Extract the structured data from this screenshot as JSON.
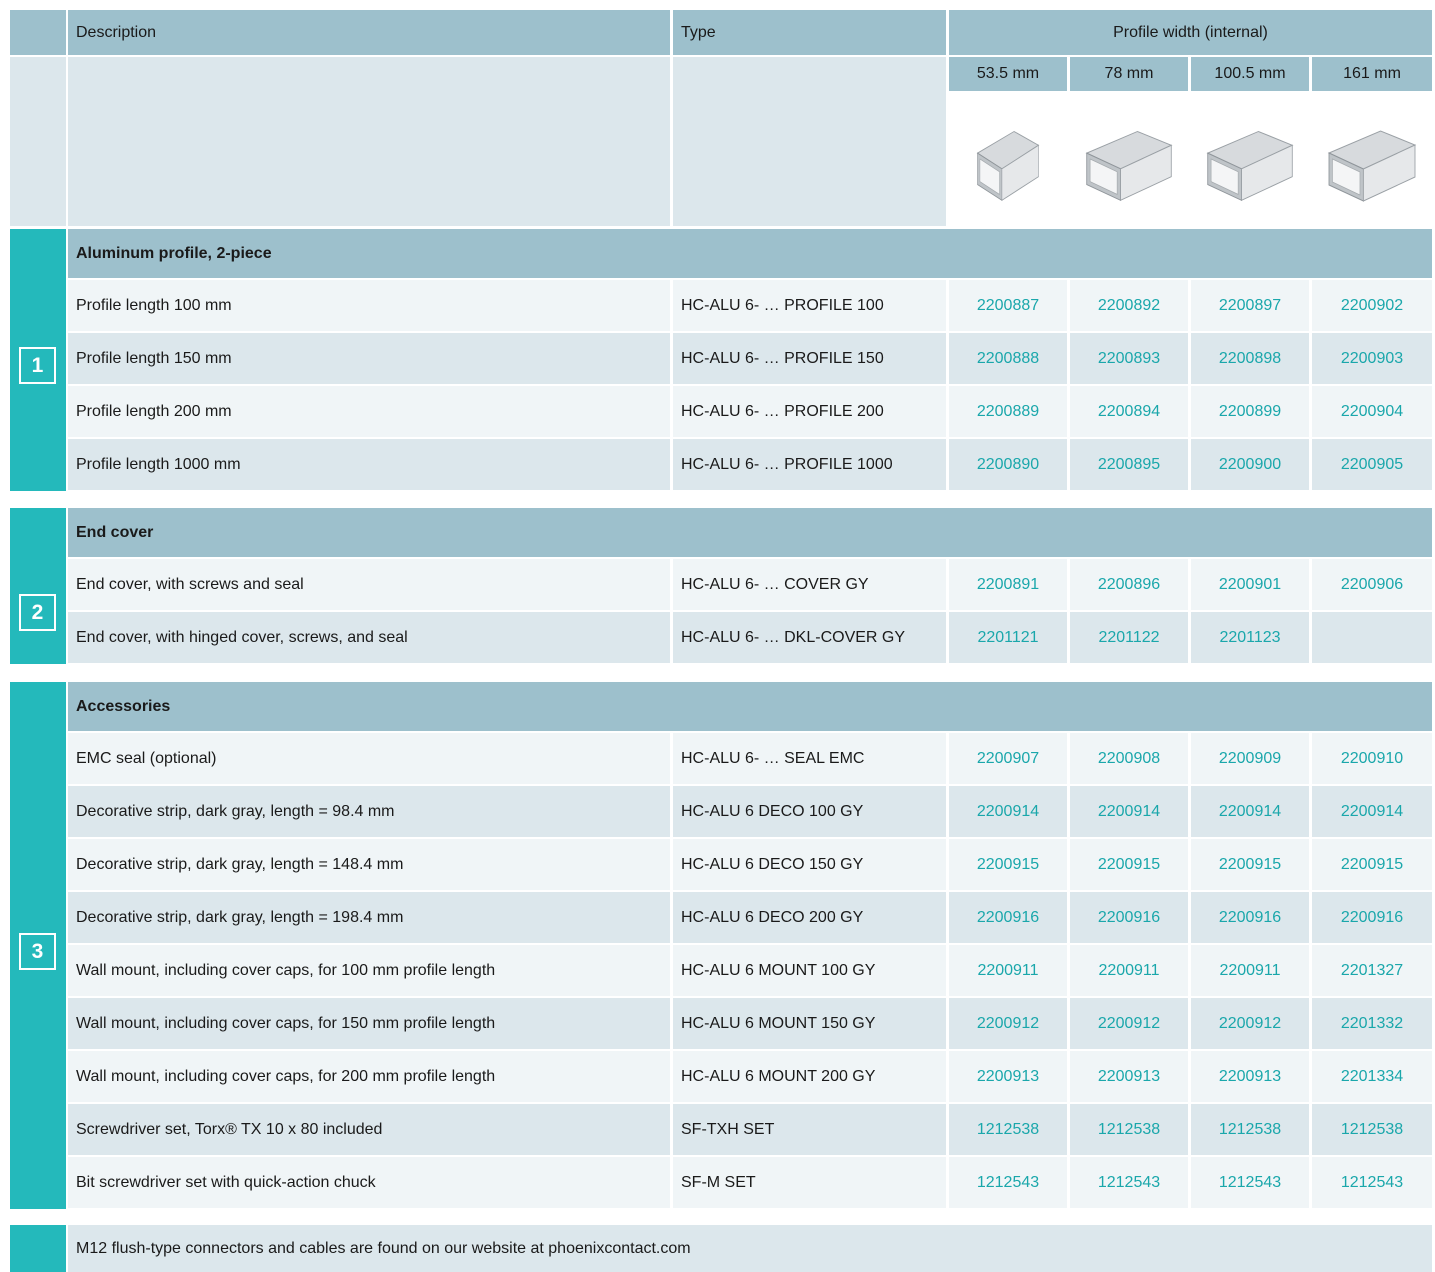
{
  "header": {
    "description": "Description",
    "type": "Type",
    "profile_width": "Profile width (internal)",
    "widths": [
      "53.5 mm",
      "78 mm",
      "100.5 mm",
      "161 mm"
    ]
  },
  "sections": [
    {
      "badge": "1",
      "title": "Aluminum profile, 2-piece",
      "rows": [
        {
          "desc": "Profile length 100 mm",
          "type": "HC-ALU 6- … PROFILE 100",
          "codes": [
            "2200887",
            "2200892",
            "2200897",
            "2200902"
          ]
        },
        {
          "desc": "Profile length 150 mm",
          "type": "HC-ALU 6- … PROFILE 150",
          "codes": [
            "2200888",
            "2200893",
            "2200898",
            "2200903"
          ]
        },
        {
          "desc": "Profile length 200 mm",
          "type": "HC-ALU 6- … PROFILE 200",
          "codes": [
            "2200889",
            "2200894",
            "2200899",
            "2200904"
          ]
        },
        {
          "desc": "Profile length 1000 mm",
          "type": "HC-ALU 6- … PROFILE 1000",
          "codes": [
            "2200890",
            "2200895",
            "2200900",
            "2200905"
          ]
        }
      ]
    },
    {
      "badge": "2",
      "title": "End cover",
      "rows": [
        {
          "desc": "End cover, with screws and seal",
          "type": "HC-ALU 6- … COVER GY",
          "codes": [
            "2200891",
            "2200896",
            "2200901",
            "2200906"
          ]
        },
        {
          "desc": "End cover, with hinged cover, screws, and seal",
          "type": "HC-ALU 6- … DKL-COVER GY",
          "codes": [
            "2201121",
            "2201122",
            "2201123",
            ""
          ]
        }
      ]
    },
    {
      "badge": "3",
      "title": "Accessories",
      "rows": [
        {
          "desc": "EMC seal (optional)",
          "type": "HC-ALU 6- … SEAL EMC",
          "codes": [
            "2200907",
            "2200908",
            "2200909",
            "2200910"
          ]
        },
        {
          "desc": "Decorative strip, dark gray, length = 98.4 mm",
          "type": "HC-ALU 6 DECO 100 GY",
          "codes": [
            "2200914",
            "2200914",
            "2200914",
            "2200914"
          ]
        },
        {
          "desc": "Decorative strip, dark gray, length = 148.4 mm",
          "type": "HC-ALU 6 DECO 150 GY",
          "codes": [
            "2200915",
            "2200915",
            "2200915",
            "2200915"
          ]
        },
        {
          "desc": "Decorative strip, dark gray, length = 198.4 mm",
          "type": "HC-ALU 6 DECO 200 GY",
          "codes": [
            "2200916",
            "2200916",
            "2200916",
            "2200916"
          ]
        },
        {
          "desc": "Wall mount, including cover caps, for 100 mm profile length",
          "type": "HC-ALU 6 MOUNT 100 GY",
          "codes": [
            "2200911",
            "2200911",
            "2200911",
            "2201327"
          ]
        },
        {
          "desc": "Wall mount, including cover caps, for 150 mm profile length",
          "type": "HC-ALU 6 MOUNT 150 GY",
          "codes": [
            "2200912",
            "2200912",
            "2200912",
            "2201332"
          ]
        },
        {
          "desc": "Wall mount, including cover caps, for 200 mm profile length",
          "type": "HC-ALU 6 MOUNT 200 GY",
          "codes": [
            "2200913",
            "2200913",
            "2200913",
            "2201334"
          ]
        },
        {
          "desc": "Screwdriver set, Torx® TX 10 x 80 included",
          "type": "SF-TXH SET",
          "codes": [
            "1212538",
            "1212538",
            "1212538",
            "1212538"
          ]
        },
        {
          "desc": "Bit screwdriver set with quick-action chuck",
          "type": "SF-M SET",
          "codes": [
            "1212543",
            "1212543",
            "1212543",
            "1212543"
          ]
        }
      ]
    }
  ],
  "footer": "M12 flush-type connectors and cables are found on our website at phoenixcontact.com",
  "colors": {
    "accent": "#24b9bb",
    "header": "#9dc0cc",
    "row_light": "#f0f5f7",
    "row_dark": "#dce7ec",
    "code_text": "#1aa7ab"
  }
}
